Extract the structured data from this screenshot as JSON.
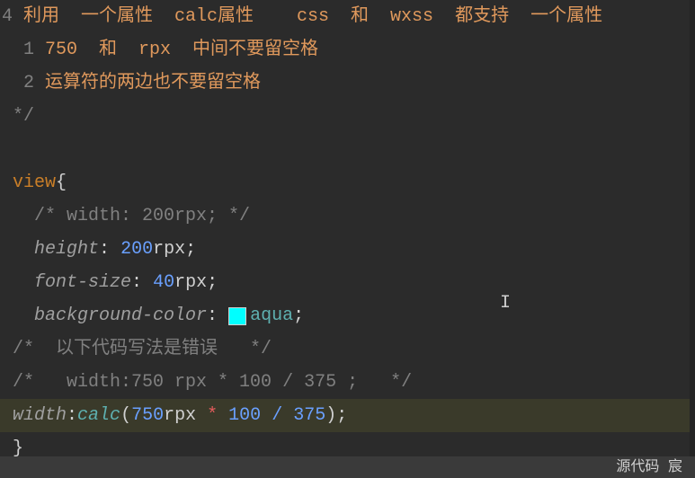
{
  "code": {
    "comment_l1_prefix": "4 ",
    "comment_l1": "利用  一个属性  calc属性    css  和  wxss  都支持  一个属性",
    "comment_l2_prefix": "  1 ",
    "comment_l2": "750  和  rpx  中间不要留空格",
    "comment_l3_prefix": "  2 ",
    "comment_l3": "运算符的两边也不要留空格",
    "comment_close": "*/",
    "selector": "view",
    "brace_open": "{",
    "brace_close": "}",
    "commented_width": "/* width: 200rpx; */",
    "prop_height": "height",
    "val_height_num": "200",
    "val_height_unit": "rpx",
    "prop_fontsize": "font-size",
    "val_fontsize_num": "40",
    "val_fontsize_unit": "rpx",
    "prop_bg": "background-color",
    "val_bg": "aqua",
    "comment_err": "/*  以下代码写法是错误   */",
    "comment_example": "/*   width:750 rpx * 100 / 375 ;   */",
    "prop_width": "width",
    "func_calc": "calc",
    "calc_num1": "750",
    "calc_unit": "rpx",
    "calc_op1": "*",
    "calc_num2": "100",
    "calc_op2": "/",
    "calc_num3": "375",
    "semi": ";",
    "colon": ":",
    "paren_open": "(",
    "paren_close": ")"
  },
  "colors": {
    "aqua_swatch": "#00ffff"
  },
  "statusbar": {
    "encoding_label": "源代码   宸"
  },
  "chart_data": null
}
